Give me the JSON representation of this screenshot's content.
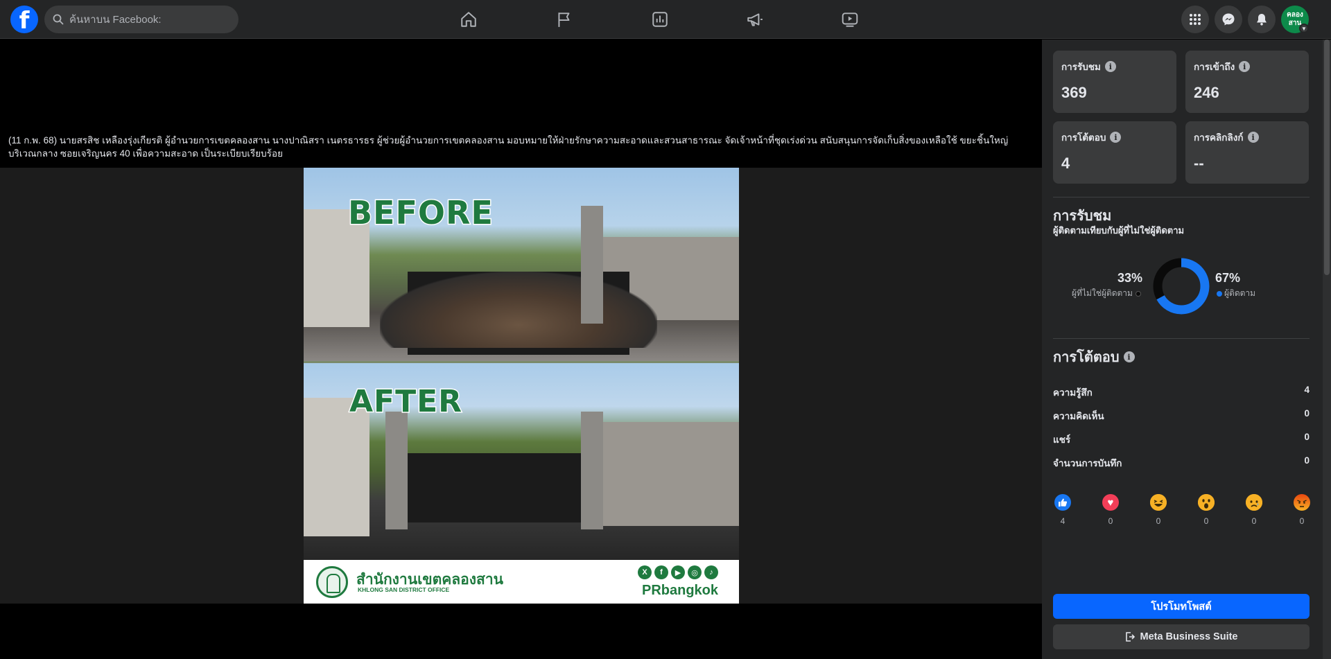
{
  "search": {
    "placeholder": "ค้นหาบน Facebook:"
  },
  "nav": {
    "icons": [
      "home-icon",
      "pages-flag-icon",
      "insights-icon",
      "ads-megaphone-icon",
      "watch-video-icon"
    ]
  },
  "header_right": {
    "icons": [
      "menu-grid-icon",
      "messenger-icon",
      "notifications-bell-icon"
    ],
    "avatar_text": "คลอง สาน"
  },
  "post": {
    "caption": "(11 ก.พ. 68) นายสรสิช เหลืองรุ่งเกียรติ ผู้อำนวยการเขตคลองสาน นางปาณิสรา เนตรธารธร ผู้ช่วยผู้อำนวยการเขตคลองสาน มอบหมายให้ฝ่ายรักษาความสะอาดและสวนสาธารณะ จัดเจ้าหน้าที่ชุดเร่งด่วน สนับสนุนการจัดเก็บสิ่งของเหลือใช้ ขยะชิ้นใหญ่ บริเวณกลาง ซอยเจริญนคร 40 เพื่อความสะอาด เป็นระเบียบเรียบร้อย",
    "image": {
      "before_label": "BEFORE",
      "after_label": "AFTER",
      "office_th": "สำนักงานเขตคลองสาน",
      "office_en": "KHLONG SAN DISTRICT OFFICE",
      "social": [
        "X",
        "f",
        "▶",
        "◎",
        "♪"
      ],
      "handle": "PRbangkok"
    }
  },
  "stats": {
    "views_label": "การรับชม",
    "views_value": "369",
    "reach_label": "การเข้าถึง",
    "reach_value": "246",
    "engagement_label": "การโต้ตอบ",
    "engagement_value": "4",
    "link_clicks_label": "การคลิกลิงก์",
    "link_clicks_value": "--"
  },
  "views_section": {
    "title": "การรับชม",
    "subtitle": "ผู้ติดตามเทียบกับผู้ที่ไม่ใช่ผู้ติดตาม",
    "non_followers_pct": "33%",
    "non_followers_label": "ผู้ที่ไม่ใช่ผู้ติดตาม",
    "followers_pct": "67%",
    "followers_label": "ผู้ติดตาม",
    "followers_fraction": 0.67,
    "followers_color": "#1877f2",
    "non_followers_color": "#0a0a0a"
  },
  "interactions": {
    "title": "การโต้ตอบ",
    "rows": [
      {
        "label": "ความรู้สึก",
        "value": "4"
      },
      {
        "label": "ความคิดเห็น",
        "value": "0"
      },
      {
        "label": "แชร์",
        "value": "0"
      },
      {
        "label": "จำนวนการบันทึก",
        "value": "0"
      }
    ],
    "reactions": [
      {
        "name": "like",
        "glyph": "👍",
        "count": "4",
        "color": "#1877f2"
      },
      {
        "name": "love",
        "glyph": "♥",
        "count": "0",
        "color": "#f33e58"
      },
      {
        "name": "haha",
        "glyph": "😆",
        "count": "0",
        "color": "#f7b125"
      },
      {
        "name": "wow",
        "glyph": "😮",
        "count": "0",
        "color": "#f7b125"
      },
      {
        "name": "sad",
        "glyph": "😢",
        "count": "0",
        "color": "#f7b125"
      },
      {
        "name": "angry",
        "glyph": "😠",
        "count": "0",
        "color": "#e9710f"
      }
    ]
  },
  "actions": {
    "promote_label": "โปรโมทโพสต์",
    "business_suite_label": "Meta Business Suite"
  }
}
